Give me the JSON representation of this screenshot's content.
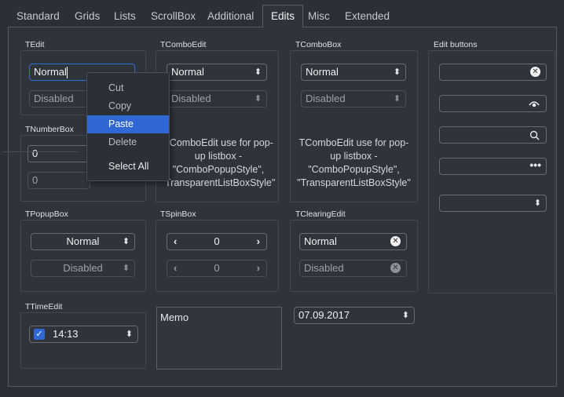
{
  "tabs": [
    {
      "label": "Standard"
    },
    {
      "label": "Grids"
    },
    {
      "label": "Lists"
    },
    {
      "label": "ScrollBox"
    },
    {
      "label": "Additional"
    },
    {
      "label": "Edits"
    },
    {
      "label": "Misc"
    },
    {
      "label": "Extended"
    }
  ],
  "active_tab": "Edits",
  "tedit": {
    "title": "TEdit",
    "value": "Normal",
    "disabled_value": "Disabled"
  },
  "tnumberbox": {
    "title": "TNumberBox",
    "value": "0",
    "disabled_value": "0"
  },
  "tcomboedit": {
    "title": "TComboEdit",
    "value": "Normal",
    "disabled_value": "Disabled",
    "note": "TComboEdit use for pop-up listbox - \"ComboPopupStyle\", \"TransparentListBoxStyle\""
  },
  "tcombobox": {
    "title": "TComboBox",
    "value": "Normal",
    "disabled_value": "Disabled",
    "note": "TComboEdit use for pop-up listbox - \"ComboPopupStyle\", \"TransparentListBoxStyle\""
  },
  "edit_buttons": {
    "title": "Edit buttons"
  },
  "tpopupbox": {
    "title": "TPopupBox",
    "value": "Normal",
    "disabled_value": "Disabled"
  },
  "tspinbox": {
    "title": "TSpinBox",
    "value": "0",
    "disabled_value": "0"
  },
  "tclearingedit": {
    "title": "TClearingEdit",
    "value": "Normal",
    "disabled_value": "Disabled"
  },
  "ttimeedit": {
    "title": "TTimeEdit",
    "value": "14:13",
    "checked": true
  },
  "memo": {
    "text": "Memo"
  },
  "date_edit": {
    "value": "07.09.2017"
  },
  "context_menu": {
    "items": [
      "Cut",
      "Copy",
      "Paste",
      "Delete",
      "Select All"
    ],
    "highlighted": "Paste"
  },
  "icons": {
    "clear": "clear-icon",
    "eye": "eye-icon",
    "search": "search-icon",
    "ellipsis": "ellipsis-icon",
    "updown": "up-down-arrow-icon",
    "left": "chevron-left-icon",
    "right": "chevron-right-icon"
  },
  "colors": {
    "accent": "#2f67d4",
    "background": "#2b2f36"
  }
}
